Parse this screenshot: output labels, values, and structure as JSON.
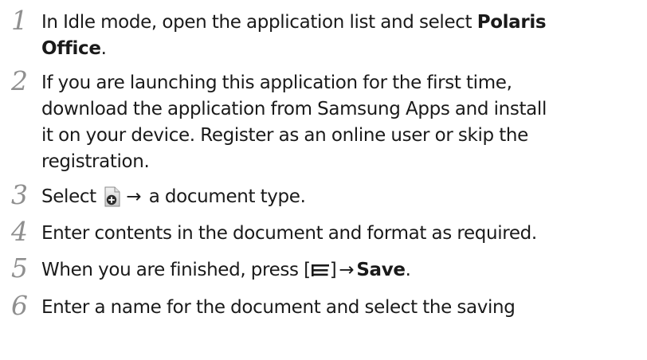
{
  "steps": [
    {
      "number": "1",
      "lines": [
        {
          "t1": "In Idle mode, open the application list and select ",
          "b1": "Polaris"
        },
        {
          "b1": "Office",
          "t2": "."
        }
      ]
    },
    {
      "number": "2",
      "lines": [
        {
          "t1": "If you are launching this application for the first time,"
        },
        {
          "t1": "download the application from Samsung Apps and install"
        },
        {
          "t1": "it on your device. Register as an online user or skip the"
        },
        {
          "t1": "registration."
        }
      ]
    },
    {
      "number": "3",
      "text_before": "Select ",
      "icon": "new-document-icon",
      "arrow": "→",
      "text_after": " a document type."
    },
    {
      "number": "4",
      "text": "Enter contents in the document and format as required."
    },
    {
      "number": "5",
      "text_before": "When you are finished, press [",
      "icon": "menu-key-icon",
      "text_mid": "]",
      "arrow": "→",
      "bold": "Save",
      "text_after": "."
    },
    {
      "number": "6",
      "text": "Enter a name for the document and select the saving"
    }
  ]
}
